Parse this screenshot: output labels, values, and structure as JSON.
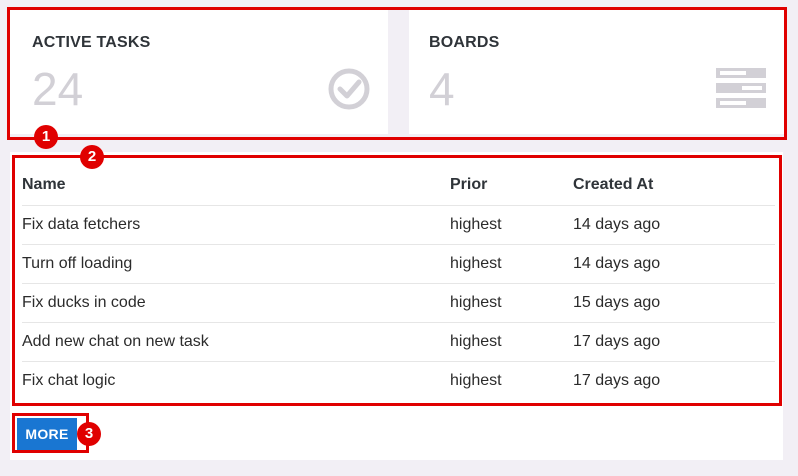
{
  "stats": {
    "tasks": {
      "title": "ACTIVE TASKS",
      "value": "24",
      "icon": "check-circle-icon"
    },
    "boards": {
      "title": "BOARDS",
      "value": "4",
      "icon": "boards-list-icon"
    }
  },
  "table": {
    "headers": {
      "name": "Name",
      "prior": "Prior",
      "created": "Created At"
    },
    "rows": [
      {
        "name": "Fix data fetchers",
        "prior": "highest",
        "created": "14 days ago"
      },
      {
        "name": "Turn off loading",
        "prior": "highest",
        "created": "14 days ago"
      },
      {
        "name": "Fix ducks in code",
        "prior": "highest",
        "created": "15 days ago"
      },
      {
        "name": "Add new chat on new task",
        "prior": "highest",
        "created": "17 days ago"
      },
      {
        "name": "Fix chat logic",
        "prior": "highest",
        "created": "17 days ago"
      }
    ]
  },
  "more_label": "MORE",
  "annotations": {
    "m1": "1",
    "m2": "2",
    "m3": "3"
  },
  "colors": {
    "accent": "#1976d2",
    "highlight": "#e00000",
    "muted_value": "#d2d0d6"
  }
}
